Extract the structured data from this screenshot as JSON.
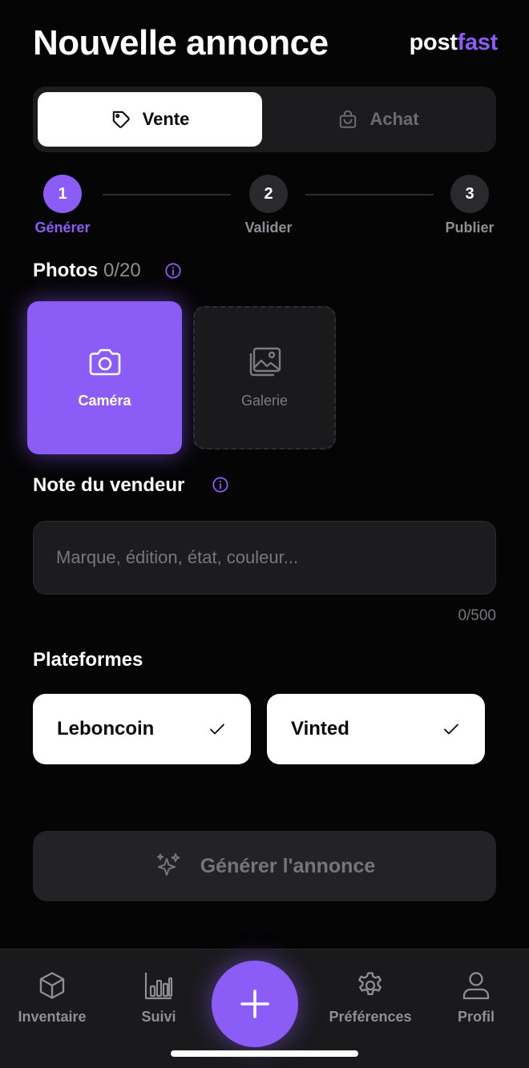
{
  "header": {
    "title": "Nouvelle annonce",
    "brand_part1": "post",
    "brand_part2": "fast"
  },
  "mode": {
    "sell_label": "Vente",
    "buy_label": "Achat"
  },
  "steps": [
    {
      "number": "1",
      "label": "Générer"
    },
    {
      "number": "2",
      "label": "Valider"
    },
    {
      "number": "3",
      "label": "Publier"
    }
  ],
  "photos": {
    "label": "Photos",
    "count": "0/20",
    "camera_label": "Caméra",
    "gallery_label": "Galerie"
  },
  "note": {
    "label": "Note du vendeur",
    "placeholder": "Marque, édition, état, couleur...",
    "counter": "0/500"
  },
  "platforms": {
    "label": "Plateformes",
    "items": [
      "Leboncoin",
      "Vinted"
    ]
  },
  "generate": {
    "label": "Générer l'annonce"
  },
  "tabbar": {
    "inventory": "Inventaire",
    "tracking": "Suivi",
    "preferences": "Préférences",
    "profile": "Profil"
  },
  "colors": {
    "accent": "#8b5cf6",
    "background": "#050506",
    "surface": "#1c1c1f"
  }
}
